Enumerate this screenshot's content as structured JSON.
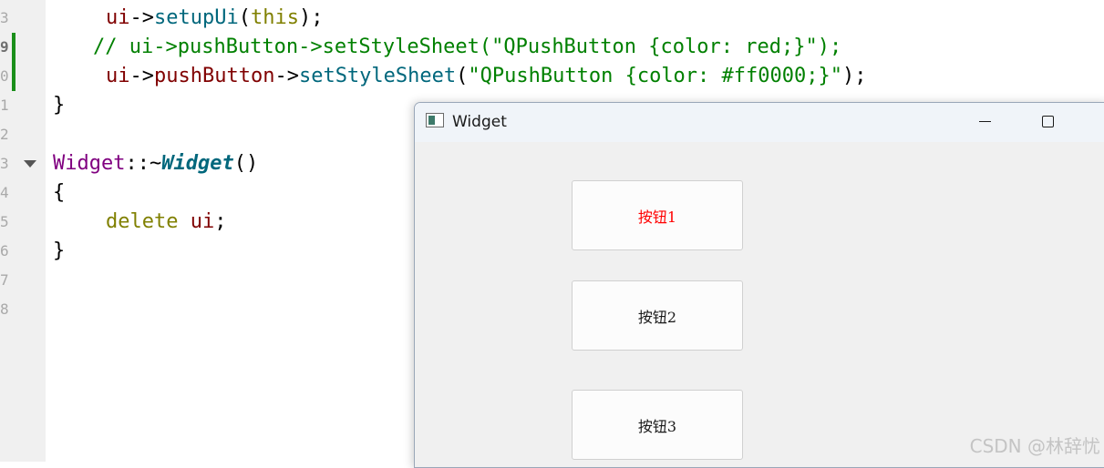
{
  "editor": {
    "line_numbers": [
      "3",
      "9",
      "0",
      "1",
      "2",
      "3",
      "4",
      "5",
      "6",
      "7",
      "8"
    ],
    "code": {
      "l1": {
        "a": "ui",
        "b": "->",
        "c": "setupUi",
        "d": "(",
        "e": "this",
        "f": ");"
      },
      "l2": {
        "comment": "// ui->pushButton->setStyleSheet(\"QPushButton {color: red;}\");"
      },
      "l3": {
        "a": "ui",
        "b": "->",
        "c": "pushButton",
        "d": "->",
        "e": "setStyleSheet",
        "f": "(",
        "g": "\"QPushButton {color: #ff0000;}\"",
        "h": ");"
      },
      "l4": {
        "a": "}"
      },
      "l6": {
        "a": "Widget",
        "b": "::~",
        "c": "Widget",
        "d": "()"
      },
      "l7": {
        "a": "{"
      },
      "l8": {
        "a": "delete",
        "b": " ",
        "c": "ui",
        "d": ";"
      },
      "l9": {
        "a": "}"
      }
    }
  },
  "window": {
    "title": "Widget",
    "icon": "app-window-icon",
    "controls": {
      "minimize_icon": "minimize-icon",
      "maximize_icon": "maximize-icon"
    },
    "buttons": [
      {
        "label": "按钮1",
        "color": "#ff0000"
      },
      {
        "label": "按钮2",
        "color": "#1a1a1a"
      },
      {
        "label": "按钮3",
        "color": "#1a1a1a"
      }
    ]
  },
  "watermark": "CSDN @林辞忧"
}
